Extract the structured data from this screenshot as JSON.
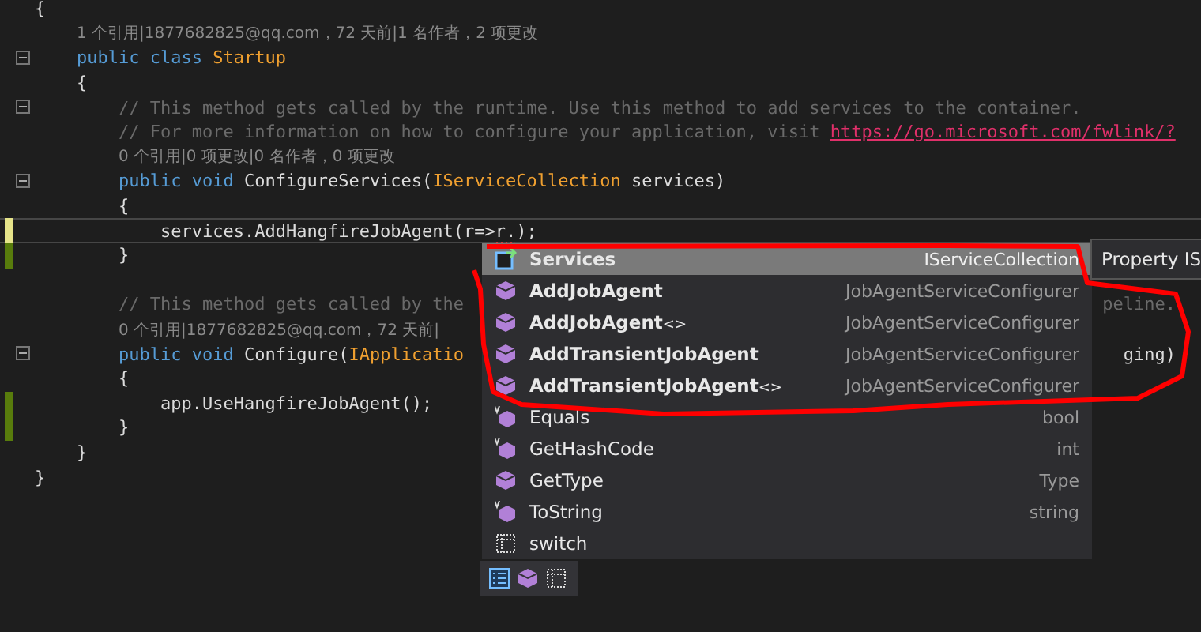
{
  "editor": {
    "lines": [
      {
        "tokens": [
          {
            "text": "{",
            "kind": "plain"
          }
        ]
      },
      {
        "tokens": [
          {
            "text": "    1 个引用|1877682825@qq.com，72 天前|1 名作者，2 项更改",
            "kind": "lens"
          }
        ]
      },
      {
        "collapsible": true,
        "tokens": [
          {
            "text": "    public class ",
            "kind": "keyword"
          },
          {
            "text": "Startup",
            "kind": "type"
          }
        ]
      },
      {
        "tokens": [
          {
            "text": "    {",
            "kind": "plain"
          }
        ]
      },
      {
        "collapsible": true,
        "tokens": [
          {
            "text": "        // This method gets called by the runtime. Use this method to add services to the container.",
            "kind": "comment"
          }
        ]
      },
      {
        "tokens": [
          {
            "text": "        // For more information on how to configure your application, visit ",
            "kind": "comment"
          },
          {
            "text": "https://go.microsoft.com/fwlink/?",
            "kind": "link"
          }
        ]
      },
      {
        "tokens": [
          {
            "text": "        0 个引用|0 项更改|0 名作者，0 项更改",
            "kind": "lens"
          }
        ]
      },
      {
        "collapsible": true,
        "tokens": [
          {
            "text": "        public void ",
            "kind": "keyword"
          },
          {
            "text": "ConfigureServices(",
            "kind": "plain"
          },
          {
            "text": "IServiceCollection",
            "kind": "type"
          },
          {
            "text": " services)",
            "kind": "plain"
          }
        ]
      },
      {
        "tokens": [
          {
            "text": "        {",
            "kind": "plain"
          }
        ]
      },
      {
        "current": true,
        "color": "#e6e48a",
        "tokens": [
          {
            "text": "            services.AddHangfireJobAgent(r=>",
            "kind": "plain"
          },
          {
            "text": "r.",
            "kind": "error"
          },
          {
            "text": ");",
            "kind": "plain"
          }
        ]
      },
      {
        "color": "#587c0c",
        "tokens": [
          {
            "text": "        }",
            "kind": "plain"
          }
        ]
      },
      {
        "blank_before": true,
        "tokens": [
          {
            "text": "        // This method gets called by the",
            "kind": "comment"
          }
        ],
        "tail": {
          "text": "peline.",
          "kind": "comment"
        }
      },
      {
        "tokens": [
          {
            "text": "        0 个引用|1877682825@qq.com，72 天前|",
            "kind": "lens"
          }
        ]
      },
      {
        "collapsible": true,
        "tokens": [
          {
            "text": "        public void ",
            "kind": "keyword"
          },
          {
            "text": "Configure(",
            "kind": "plain"
          },
          {
            "text": "IApplicatio",
            "kind": "type"
          }
        ],
        "tail": {
          "text": "ging)",
          "kind": "plain"
        }
      },
      {
        "tokens": [
          {
            "text": "        {",
            "kind": "plain"
          }
        ]
      },
      {
        "color": "#587c0c",
        "tokens": [
          {
            "text": "            app.UseHangfireJobAgent();",
            "kind": "plain"
          }
        ]
      },
      {
        "color": "#587c0c",
        "tokens": [
          {
            "text": "        }",
            "kind": "plain"
          }
        ]
      },
      {
        "tokens": [
          {
            "text": "    }",
            "kind": "plain"
          }
        ]
      },
      {
        "tokens": [
          {
            "text": "}",
            "kind": "plain"
          }
        ]
      }
    ]
  },
  "completion": {
    "items": [
      {
        "kind": "property",
        "name": "Services",
        "type": "IServiceCollection",
        "bold": true,
        "selected": true
      },
      {
        "kind": "extension",
        "name": "AddJobAgent",
        "type": "JobAgentServiceConfigurer",
        "bold": true,
        "selected": false
      },
      {
        "kind": "extension",
        "name": "AddJobAgent",
        "suffix": "<>",
        "type": "JobAgentServiceConfigurer",
        "bold": true,
        "selected": false
      },
      {
        "kind": "extension",
        "name": "AddTransientJobAgent",
        "type": "JobAgentServiceConfigurer",
        "bold": true,
        "selected": false
      },
      {
        "kind": "extension",
        "name": "AddTransientJobAgent",
        "suffix": "<>",
        "type": "JobAgentServiceConfigurer",
        "bold": true,
        "selected": false
      },
      {
        "kind": "override",
        "name": "Equals",
        "type": "bool",
        "bold": false,
        "selected": false
      },
      {
        "kind": "override",
        "name": "GetHashCode",
        "type": "int",
        "bold": false,
        "selected": false
      },
      {
        "kind": "method",
        "name": "GetType",
        "type": "Type",
        "bold": false,
        "selected": false
      },
      {
        "kind": "override",
        "name": "ToString",
        "type": "string",
        "bold": false,
        "selected": false
      },
      {
        "kind": "snippet",
        "name": "switch",
        "bold": false,
        "selected": false
      }
    ],
    "tooltip": "Property IS"
  }
}
